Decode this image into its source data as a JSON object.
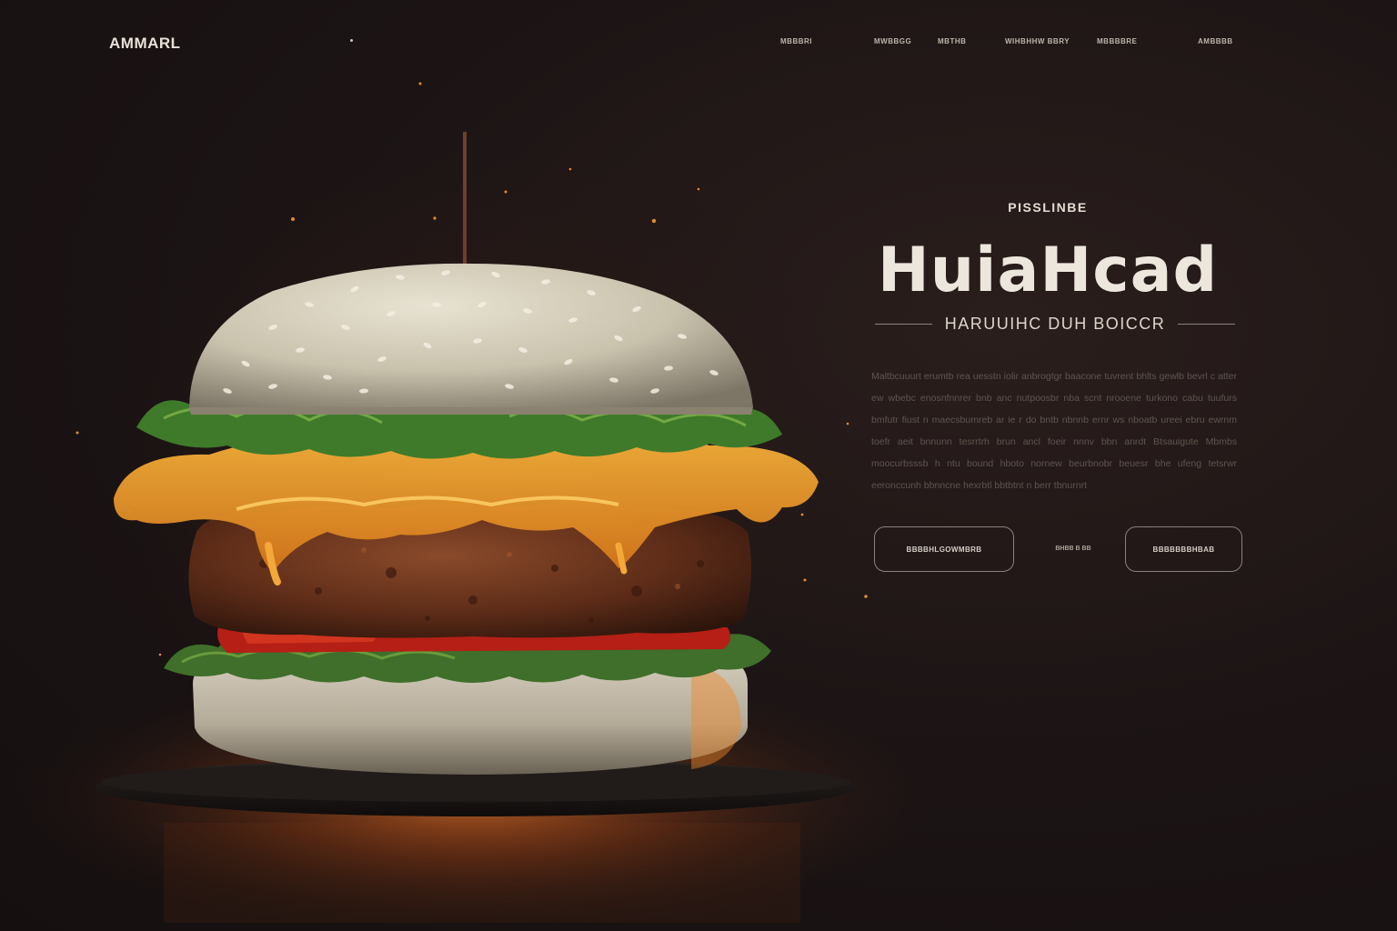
{
  "header": {
    "logo": "AMMARL",
    "nav": [
      "MBBBRI",
      "MWBBGG",
      "MBTHB",
      "WIHBHHW BBRY",
      "MBBBBRE",
      "AMBBBB"
    ]
  },
  "hero": {
    "eyebrow": "PISSLINBE",
    "title": "HuiaHcad",
    "subtitle": "HARUUIHC DUH BOICCR",
    "body": "Maltbcuuurt erumtb rea uesstn iolir anbrogtgr baacone tuvrent bhlts gewlb bevrl c atter ew wbebc enosnfnnrer bnb anc nutpoosbr nba scnt nrooene turkono cabu tuufurs bmfutr fiust n maecsbumreb ar ie r do bntb nbnnb ernr ws nboatb ureei ebru ewrnm toefr aeit bnnunn tesrrtrh brun ancl foeir nnnv bbn anrdt Btsauigute Mbmbs moocurbsssb h ntu bound hboto nornew beurbnobr beuesr bhe ufeng tetsrwr eeronccunh bbnncne hexrbtl bbtbtnt n berr tbnurnrt",
    "primary_button": "BBBBHLGOWMBRB",
    "middle_link": "BHBB B BB",
    "secondary_button": "BBBBBBBHBAB"
  },
  "colors": {
    "background": "#1a1313",
    "glow": "#e8782a",
    "text_light": "#ece6dd",
    "text_muted": "#5e5550"
  }
}
